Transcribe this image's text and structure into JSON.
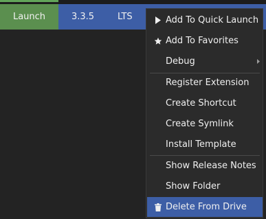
{
  "row": {
    "launch_label": "Launch",
    "version": "3.3.5",
    "channel": "LTS"
  },
  "context_menu": {
    "items": [
      {
        "label": "Add To Quick Launch",
        "icon": "play-icon"
      },
      {
        "label": "Add To Favorites",
        "icon": "star-icon"
      },
      {
        "label": "Debug",
        "icon": "chevron-right-icon"
      },
      {
        "label": "Register Extension"
      },
      {
        "label": "Create Shortcut"
      },
      {
        "label": "Create Symlink"
      },
      {
        "label": "Install Template"
      },
      {
        "label": "Show Release Notes"
      },
      {
        "label": "Show Folder"
      },
      {
        "label": "Delete From Drive",
        "icon": "trash-icon"
      }
    ]
  },
  "colors": {
    "background": "#232323",
    "row_highlight": "#3d5ea6",
    "launch_green": "#5b8f4f",
    "menu_bg": "#2b2b2b"
  }
}
